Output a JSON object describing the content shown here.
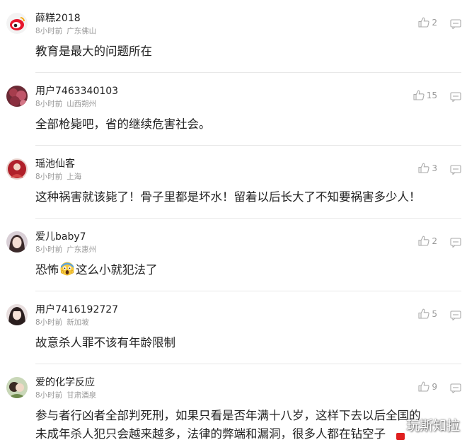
{
  "comments": [
    {
      "username": "薛糕2018",
      "time": "8小时前",
      "location": "广东佛山",
      "content": "教育是最大的问题所在",
      "likes": "2",
      "avatar": "weibo-logo"
    },
    {
      "username": "用户7463340103",
      "time": "8小时前",
      "location": "山西朔州",
      "content": "全部枪毙吧，省的继续危害社会。",
      "likes": "15",
      "avatar": "photo-avatar"
    },
    {
      "username": "瑶池仙客",
      "time": "8小时前",
      "location": "上海",
      "content": "这种祸害就该毙了！骨子里都是坏水！留着以后长大了不知要祸害多少人！",
      "likes": "3",
      "avatar": "photo-avatar"
    },
    {
      "username": "爱儿baby7",
      "time": "8小时前",
      "location": "广东惠州",
      "content_before": "恐怖",
      "content_emoji": "screaming-face-emoji",
      "content_after": "这么小就犯法了",
      "likes": "2",
      "avatar": "photo-avatar"
    },
    {
      "username": "用户7416192727",
      "time": "8小时前",
      "location": "新加坡",
      "content": "故意杀人罪不该有年龄限制",
      "likes": "5",
      "avatar": "photo-avatar"
    },
    {
      "username": "爱的化学反应",
      "time": "8小时前",
      "location": "甘肃酒泉",
      "content_line1": "参与者行凶者全部判死刑，如果只看是否年满十八岁，这样下去以后全国的",
      "content_line2": "未成年杀人犯只会越来越多，法律的弊端和漏洞，很多人都在钻空子",
      "likes": "9",
      "avatar": "photo-avatar"
    }
  ],
  "watermark": "玩斯知拉",
  "colors": {
    "text": "#222222",
    "meta": "#999999",
    "divider": "#e8e8e8",
    "icon": "#aaaaaa"
  }
}
